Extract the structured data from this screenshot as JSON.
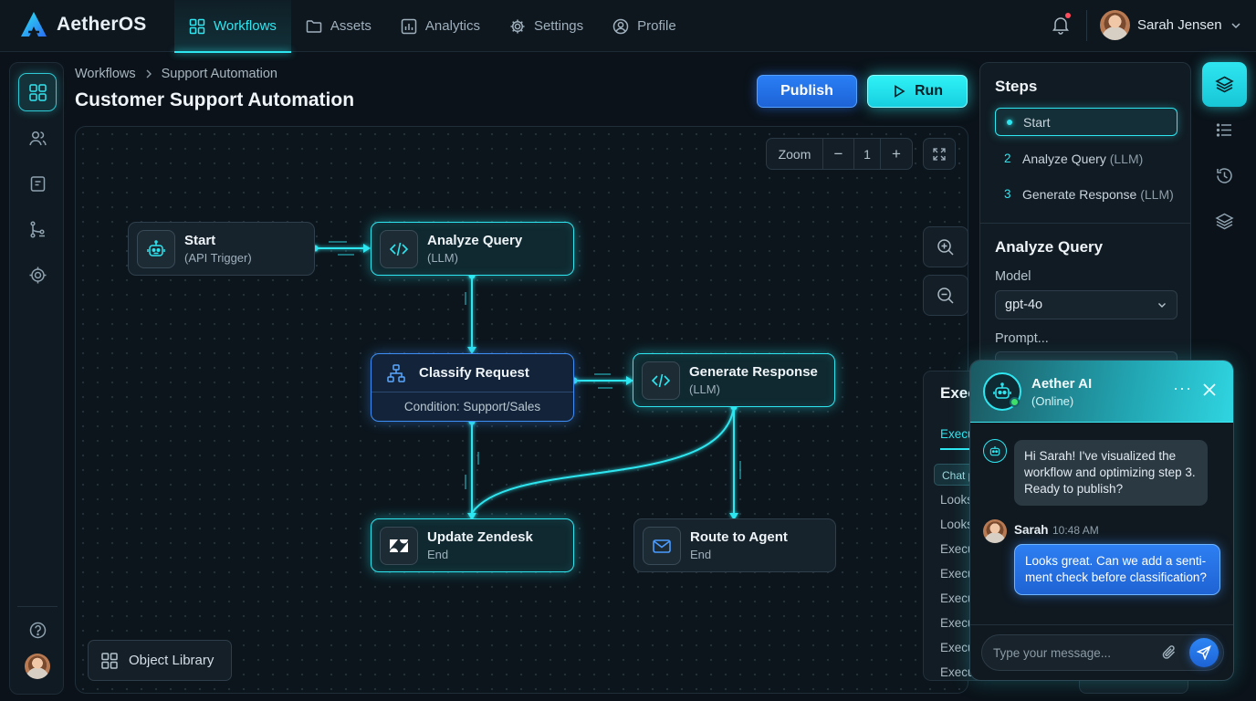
{
  "app": {
    "name": "AetherOS"
  },
  "nav": [
    {
      "label": "Workflows",
      "icon": "grid-icon",
      "active": true
    },
    {
      "label": "Assets",
      "icon": "folder-icon"
    },
    {
      "label": "Analytics",
      "icon": "chart-icon"
    },
    {
      "label": "Settings",
      "icon": "gear-icon"
    },
    {
      "label": "Profile",
      "icon": "user-icon"
    }
  ],
  "user": {
    "name": "Sarah Jensen"
  },
  "breadcrumb": [
    "Workflows",
    "Support Automation"
  ],
  "page": {
    "title": "Customer Support Automation"
  },
  "actions": {
    "publish": "Publish",
    "run": "Run"
  },
  "zoom": {
    "label": "Zoom",
    "minus": "−",
    "value": "1",
    "plus": "+"
  },
  "nodes": {
    "start": {
      "title": "Start",
      "sub": "(API Trigger)",
      "icon": "robot-icon"
    },
    "analyze": {
      "title": "Analyze Query",
      "sub": "(LLM)",
      "icon": "code-icon"
    },
    "classify": {
      "title": "Classify Request",
      "sub": "Condition: Support/Sales",
      "icon": "hierarchy-icon"
    },
    "generate": {
      "title": "Generate Response",
      "sub": "(LLM)",
      "icon": "code-icon"
    },
    "zendesk": {
      "title": "Update Zendesk",
      "sub": "End",
      "icon": "zendesk-icon"
    },
    "route": {
      "title": "Route to Agent",
      "sub": "End",
      "icon": "mail-icon"
    }
  },
  "object_library": "Object Library",
  "steps": {
    "title": "Steps",
    "items": [
      {
        "num": "",
        "label": "Start",
        "tag": "",
        "active": true
      },
      {
        "num": "2",
        "label": "Analyze Query",
        "tag": "(LLM)"
      },
      {
        "num": "3",
        "label": "Generate Response",
        "tag": "(LLM)"
      }
    ]
  },
  "inspector": {
    "title": "Analyze Query",
    "model_label": "Model",
    "model_value": "gpt-4o",
    "prompt_label": "Prompt..."
  },
  "execution": {
    "title": "Exec",
    "tab": "Execu",
    "chip": "Chat p",
    "rows": [
      "Looks",
      "Looks",
      "Execu",
      "Execu",
      "Execu",
      "Execu",
      "Execu",
      "Execu"
    ]
  },
  "chat": {
    "name": "Aether AI",
    "status": "(Online)",
    "bot_message": "Hi Sarah! I've visualized the workflow and optimizing step 3. Ready to publish?",
    "user_name": "Sarah",
    "user_time": "10:48 AM",
    "user_message": "Looks great. Can we add a senti-ment check before classification?",
    "input_placeholder": "Type your message..."
  },
  "colors": {
    "accent": "#2ee6f0",
    "primary": "#2a7ef5",
    "background": "#0b1219"
  }
}
